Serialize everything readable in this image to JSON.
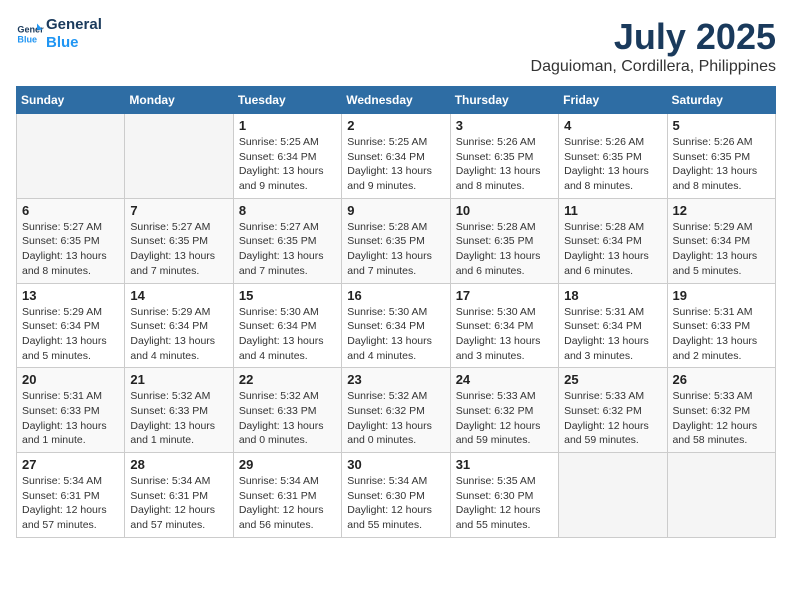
{
  "header": {
    "logo_line1": "General",
    "logo_line2": "Blue",
    "month": "July 2025",
    "location": "Daguioman, Cordillera, Philippines"
  },
  "weekdays": [
    "Sunday",
    "Monday",
    "Tuesday",
    "Wednesday",
    "Thursday",
    "Friday",
    "Saturday"
  ],
  "weeks": [
    [
      {
        "day": "",
        "empty": true
      },
      {
        "day": "",
        "empty": true
      },
      {
        "day": "1",
        "sunrise": "5:25 AM",
        "sunset": "6:34 PM",
        "daylight": "13 hours and 9 minutes."
      },
      {
        "day": "2",
        "sunrise": "5:25 AM",
        "sunset": "6:34 PM",
        "daylight": "13 hours and 9 minutes."
      },
      {
        "day": "3",
        "sunrise": "5:26 AM",
        "sunset": "6:35 PM",
        "daylight": "13 hours and 8 minutes."
      },
      {
        "day": "4",
        "sunrise": "5:26 AM",
        "sunset": "6:35 PM",
        "daylight": "13 hours and 8 minutes."
      },
      {
        "day": "5",
        "sunrise": "5:26 AM",
        "sunset": "6:35 PM",
        "daylight": "13 hours and 8 minutes."
      }
    ],
    [
      {
        "day": "6",
        "sunrise": "5:27 AM",
        "sunset": "6:35 PM",
        "daylight": "13 hours and 8 minutes."
      },
      {
        "day": "7",
        "sunrise": "5:27 AM",
        "sunset": "6:35 PM",
        "daylight": "13 hours and 7 minutes."
      },
      {
        "day": "8",
        "sunrise": "5:27 AM",
        "sunset": "6:35 PM",
        "daylight": "13 hours and 7 minutes."
      },
      {
        "day": "9",
        "sunrise": "5:28 AM",
        "sunset": "6:35 PM",
        "daylight": "13 hours and 7 minutes."
      },
      {
        "day": "10",
        "sunrise": "5:28 AM",
        "sunset": "6:35 PM",
        "daylight": "13 hours and 6 minutes."
      },
      {
        "day": "11",
        "sunrise": "5:28 AM",
        "sunset": "6:34 PM",
        "daylight": "13 hours and 6 minutes."
      },
      {
        "day": "12",
        "sunrise": "5:29 AM",
        "sunset": "6:34 PM",
        "daylight": "13 hours and 5 minutes."
      }
    ],
    [
      {
        "day": "13",
        "sunrise": "5:29 AM",
        "sunset": "6:34 PM",
        "daylight": "13 hours and 5 minutes."
      },
      {
        "day": "14",
        "sunrise": "5:29 AM",
        "sunset": "6:34 PM",
        "daylight": "13 hours and 4 minutes."
      },
      {
        "day": "15",
        "sunrise": "5:30 AM",
        "sunset": "6:34 PM",
        "daylight": "13 hours and 4 minutes."
      },
      {
        "day": "16",
        "sunrise": "5:30 AM",
        "sunset": "6:34 PM",
        "daylight": "13 hours and 4 minutes."
      },
      {
        "day": "17",
        "sunrise": "5:30 AM",
        "sunset": "6:34 PM",
        "daylight": "13 hours and 3 minutes."
      },
      {
        "day": "18",
        "sunrise": "5:31 AM",
        "sunset": "6:34 PM",
        "daylight": "13 hours and 3 minutes."
      },
      {
        "day": "19",
        "sunrise": "5:31 AM",
        "sunset": "6:33 PM",
        "daylight": "13 hours and 2 minutes."
      }
    ],
    [
      {
        "day": "20",
        "sunrise": "5:31 AM",
        "sunset": "6:33 PM",
        "daylight": "13 hours and 1 minute."
      },
      {
        "day": "21",
        "sunrise": "5:32 AM",
        "sunset": "6:33 PM",
        "daylight": "13 hours and 1 minute."
      },
      {
        "day": "22",
        "sunrise": "5:32 AM",
        "sunset": "6:33 PM",
        "daylight": "13 hours and 0 minutes."
      },
      {
        "day": "23",
        "sunrise": "5:32 AM",
        "sunset": "6:32 PM",
        "daylight": "13 hours and 0 minutes."
      },
      {
        "day": "24",
        "sunrise": "5:33 AM",
        "sunset": "6:32 PM",
        "daylight": "12 hours and 59 minutes."
      },
      {
        "day": "25",
        "sunrise": "5:33 AM",
        "sunset": "6:32 PM",
        "daylight": "12 hours and 59 minutes."
      },
      {
        "day": "26",
        "sunrise": "5:33 AM",
        "sunset": "6:32 PM",
        "daylight": "12 hours and 58 minutes."
      }
    ],
    [
      {
        "day": "27",
        "sunrise": "5:34 AM",
        "sunset": "6:31 PM",
        "daylight": "12 hours and 57 minutes."
      },
      {
        "day": "28",
        "sunrise": "5:34 AM",
        "sunset": "6:31 PM",
        "daylight": "12 hours and 57 minutes."
      },
      {
        "day": "29",
        "sunrise": "5:34 AM",
        "sunset": "6:31 PM",
        "daylight": "12 hours and 56 minutes."
      },
      {
        "day": "30",
        "sunrise": "5:34 AM",
        "sunset": "6:30 PM",
        "daylight": "12 hours and 55 minutes."
      },
      {
        "day": "31",
        "sunrise": "5:35 AM",
        "sunset": "6:30 PM",
        "daylight": "12 hours and 55 minutes."
      },
      {
        "day": "",
        "empty": true
      },
      {
        "day": "",
        "empty": true
      }
    ]
  ]
}
